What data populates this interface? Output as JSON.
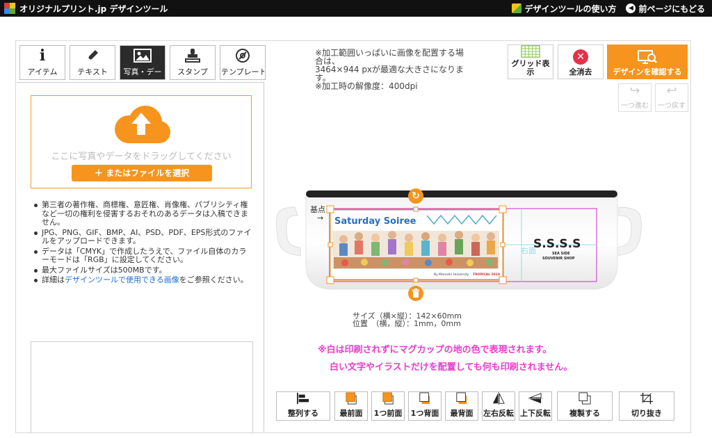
{
  "header": {
    "brand": "オリジナルプリント.jp デザインツール",
    "help_link": "デザインツールの使い方",
    "back_link": "前ページにもどる"
  },
  "tabs": [
    {
      "label": "アイテム",
      "icon": "info-icon"
    },
    {
      "label": "テキスト",
      "icon": "pen-icon"
    },
    {
      "label": "写真・デー",
      "icon": "image-icon",
      "active": true
    },
    {
      "label": "スタンプ",
      "icon": "stamp-icon"
    },
    {
      "label": "テンプレート",
      "icon": "template-icon"
    }
  ],
  "upload": {
    "drop_text": "ここに写真やデータをドラッグしてください",
    "file_button": "＋ またはファイルを選択",
    "notes": [
      "第三者の著作権、商標権、意匠権、肖像権、パブリシティ権など一切の権利を侵害するおそれのあるデータは入稿できません。",
      "JPG、PNG、GIF、BMP、AI、PSD、PDF、EPS形式のファイルをアップロードできます。",
      "データは「CMYK」で作成したうえで、ファイル自体のカラーモードは「RGB」に設定してください。",
      "最大ファイルサイズは500MBです。"
    ],
    "note_link_prefix": "詳細は",
    "note_link_text": "デザインツールで使用できる画像",
    "note_link_suffix": "をご参照ください。"
  },
  "info": {
    "line1": "※加工範囲いっぱいに画像を配置する場合は、",
    "line2": "3464×944 pxが最適な大きさになります。",
    "line3": "※加工時の解像度：400dpi"
  },
  "toolbar": {
    "grid": "グリッド表示",
    "clear": "全消去",
    "confirm": "デザインを確認する",
    "redo": "一つ進む",
    "undo": "一つ戻す"
  },
  "canvas": {
    "origin_label": "基点",
    "origin_arrow": "→",
    "right_label": "右面",
    "brand_text": "S.S.S.S",
    "brand_sub1": "SEA SIDE",
    "brand_sub2": "SOUVENIR SHOP",
    "artwork_title": "Saturday Soiree",
    "artwork_credit": "By Marcelin University",
    "artwork_tag": "TROPICAL 2018"
  },
  "size_info": {
    "size": "サイズ（横×縦）：142×60mm",
    "position": "位置　（横，縦）：1mm，0mm"
  },
  "warnings": {
    "line1": "※白は印刷されずにマグカップの地の色で表現されます。",
    "line2": "白い文字やイラストだけを配置しても何も印刷されません。"
  },
  "bottom_buttons": [
    "整列する",
    "最前面",
    "1つ前面",
    "1つ背面",
    "最背面",
    "左右反転",
    "上下反転",
    "複製する",
    "切り抜き"
  ],
  "colors": {
    "accent": "#f7941d",
    "warning": "#e83ccc",
    "selection": "#d12bd1"
  }
}
